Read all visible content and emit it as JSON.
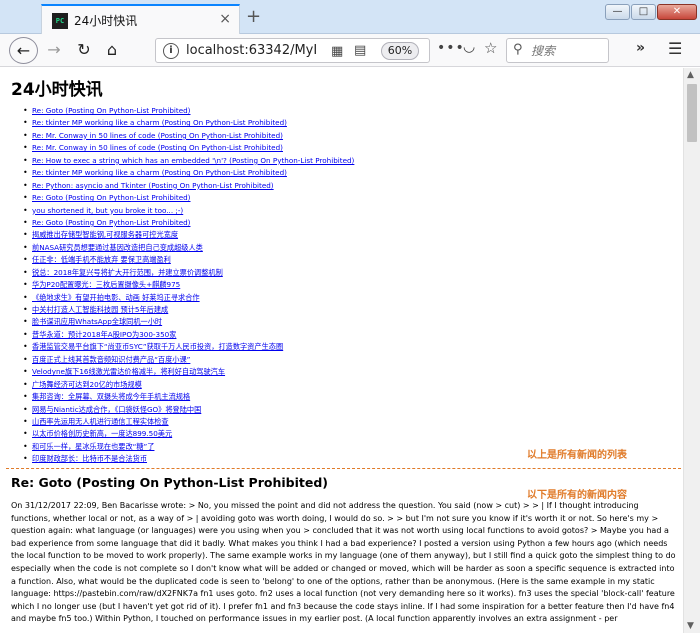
{
  "window": {
    "tab_title": "24小时快讯",
    "tab_close": "×",
    "new_tab": "+",
    "min_label": "—",
    "max_label": "□",
    "close_label": "✕"
  },
  "navbar": {
    "back": "←",
    "forward": "→",
    "reload": "↻",
    "home": "⌂",
    "url": "localhost:63342/MyI",
    "zoom": "60%",
    "search_placeholder": "搜索",
    "overflow": "»",
    "menu": "☰",
    "icons": [
      "info-icon",
      "qr-code-icon",
      "reader-view-icon",
      "more-actions-icon",
      "pocket-icon",
      "bookmark-star-icon",
      "search-icon",
      "overflow-icon",
      "hamburger-menu-icon"
    ]
  },
  "page": {
    "title": "24小时快讯",
    "news_items": [
      "Re: Goto (Posting On Python-List Prohibited)",
      "Re: tkinter MP working like a charm (Posting On Python-List Prohibited)",
      "Re: Mr. Conway in 50 lines of code (Posting On Python-List Prohibited)",
      "Re: Mr. Conway in 50 lines of code (Posting On Python-List Prohibited)",
      "Re: How to exec a string which has an embedded '\\n'? (Posting On Python-List Prohibited)",
      "Re: tkinter MP working like a charm (Posting On Python-List Prohibited)",
      "Re: Python: asyncio and Tkinter (Posting On Python-List Prohibited)",
      "Re: Goto (Posting On Python-List Prohibited)",
      "you shortened it, but you broke it too... ;-)",
      "Re: Goto (Posting On Python-List Prohibited)",
      "揭威推出存储型智能钢,可视服务器可控光宽度",
      "前NASA研究员想要通过基因改造把自己变成超级人类",
      "任正非：低端手机不能放弃 要保卫高端盈利",
      "锐总：2018年复兴号将扩大开行范围，并建立票价调整机制",
      "华为P20配置曝光：三枚后置摄像头+麒麟975",
      "《绝地求生》有望开拍电影、动画 好莱坞正寻求合作",
      "中关村打造人工智能科技园 预计5年后建成",
      "脸书谋讯应用WhatsApp全球同机一小时",
      "普华永道：预计2018年A股IPO为300-350家",
      "香港监管交易平台旗下“尚亚币SYC”获取千万人民币投资，打造数字资产生态圈",
      "百度正式上线其首款音频知识付费产品“百度小课”",
      "Velodyne旗下16线激光雷达价格减半，将利好自动驾驶汽车",
      "广场舞经济可达到20亿的市场规模",
      "集邦咨询：全屏幕、双摄头将成今年手机主流规格",
      "网易与Niantic达成合作，《口袋妖怪GO》将登陆中国",
      "山西率先运用无人机进行通信工程实体检查",
      "以太币价格创历史新高，一度达899.50美元",
      "和可乐一样，星冰乐现在也要改“糖”了",
      "印度财政部长：比特币不是合法货币"
    ],
    "note_list": "以上是所有新闻的列表",
    "note_content": "以下是所有的新闻内容",
    "article_title": "Re: Goto (Posting On Python-List Prohibited)",
    "article_body": "On 31/12/2017 22:09, Ben Bacarisse wrote: > No, you missed the point and did not address the question. You said (now > cut) > > | If I thought introducing functions, whether local or not, as a way of > | avoiding goto was worth doing, I would do so. > > but I'm not sure you know if it's worth it or not. So here's my > question again: what language (or languages) were you using when you > concluded that it was not worth using local functions to avoid gotos? > Maybe you had a bad experience from some language that did it badly. What makes you think I had a bad experience? I posted a version using Python a few hours ago (which needs the local function to be moved to work properly). The same example works in my language (one of them anyway), but I still find a quick goto the simplest thing to do especially when the code is not complete so I don't know what will be added or changed or moved, which will be harder as soon a specific sequence is extracted into a function. Also, what would be the duplicated code is seen to 'belong' to one of the options, rather than be anonymous. (Here is the same example in my static language: https://pastebin.com/raw/dX2FNK7a fn1 uses goto. fn2 uses a local function (not very demanding here so it works). fn3 uses the special 'block-call' feature which I no longer use (but I haven't yet got rid of it). I prefer fn1 and fn3 because the code stays inline. If I had some inspiration for a better feature then I'd have fn4 and maybe fn5 too.) Within Python, I touched on performance issues in my earlier post. (A local function apparently involves an extra assignment - per"
  }
}
